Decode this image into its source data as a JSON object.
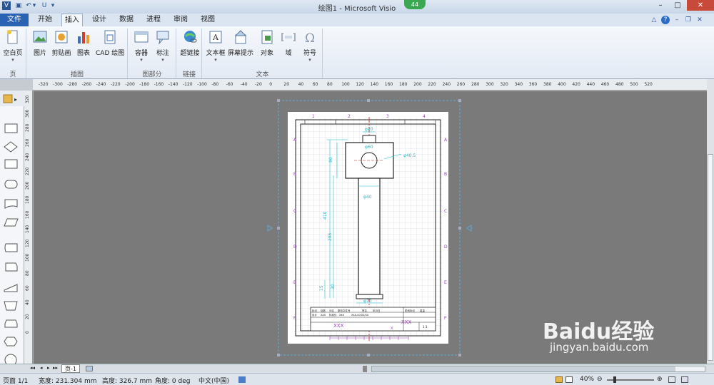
{
  "window": {
    "title": "绘图1 - Microsoft Visio",
    "badge": "44",
    "minimize": "–",
    "maximize": "□",
    "close": "✕"
  },
  "qat": {
    "app_icon": "V",
    "save": "▣",
    "undo": "↶",
    "undo_dd": "▾",
    "redo": "U",
    "customize": "▾"
  },
  "tabs": [
    {
      "label": "文件"
    },
    {
      "label": "开始"
    },
    {
      "label": "插入"
    },
    {
      "label": "设计"
    },
    {
      "label": "数据"
    },
    {
      "label": "进程"
    },
    {
      "label": "审阅"
    },
    {
      "label": "视图"
    }
  ],
  "tabbar_icons": {
    "collapse": "△",
    "help": "?",
    "minimize": "–",
    "restore": "❐",
    "close": "✕"
  },
  "ribbon": {
    "buttons": [
      {
        "label": "空白页",
        "icon": "blank-page-icon",
        "dd": "▾"
      },
      {
        "label": "图片",
        "icon": "picture-icon",
        "dd": ""
      },
      {
        "label": "剪贴画",
        "icon": "clipart-icon",
        "dd": ""
      },
      {
        "label": "图表",
        "icon": "chart-icon",
        "dd": ""
      },
      {
        "label": "CAD 绘图",
        "icon": "cad-icon",
        "dd": ""
      },
      {
        "label": "容器",
        "icon": "container-icon",
        "dd": "▾"
      },
      {
        "label": "标注",
        "icon": "callout-icon",
        "dd": "▾"
      },
      {
        "label": "超链接",
        "icon": "hyperlink-icon",
        "dd": ""
      },
      {
        "label": "文本框",
        "icon": "textbox-icon",
        "dd": "▾"
      },
      {
        "label": "屏幕提示",
        "icon": "screentip-icon",
        "dd": ""
      },
      {
        "label": "对象",
        "icon": "object-icon",
        "dd": ""
      },
      {
        "label": "域",
        "icon": "field-icon",
        "dd": ""
      },
      {
        "label": "符号",
        "icon": "symbol-icon",
        "dd": "▾"
      }
    ],
    "groups": [
      {
        "label": "页"
      },
      {
        "label": "插图"
      },
      {
        "label": "图部分"
      },
      {
        "label": "链接"
      },
      {
        "label": "文本"
      }
    ]
  },
  "ruler": {
    "h_ticks": [
      "-320",
      "-300",
      "-280",
      "-260",
      "-240",
      "-220",
      "-200",
      "-180",
      "-160",
      "-140",
      "-120",
      "-100",
      "-80",
      "-60",
      "-40",
      "-20",
      "0",
      "20",
      "40",
      "60",
      "80",
      "100",
      "120",
      "140",
      "160",
      "180",
      "200",
      "220",
      "240",
      "260",
      "280",
      "300",
      "320",
      "340",
      "360",
      "380",
      "400",
      "420",
      "440",
      "460",
      "480",
      "500",
      "520"
    ],
    "v_ticks": [
      "320",
      "300",
      "280",
      "260",
      "240",
      "220",
      "200",
      "180",
      "160",
      "140",
      "120",
      "100",
      "80",
      "60",
      "40",
      "20",
      "0"
    ]
  },
  "shapes_panel": {
    "header_icon": "shapes-icon",
    "arrow": "▸"
  },
  "drawing": {
    "dims": [
      "φ20",
      "φ60",
      "φ40.5",
      "φ40",
      "φ70",
      "90",
      "410",
      "295",
      "15",
      "30"
    ],
    "zone_cols": [
      "1",
      "2",
      "3",
      "4"
    ],
    "zone_rows": [
      "A",
      "B",
      "C",
      "D",
      "E",
      "F"
    ],
    "title_block": {
      "row1": [
        "标记",
        "处数",
        "分区",
        "更改文件号",
        "签名",
        "年月日"
      ],
      "row2": [
        "设计",
        "XXX",
        "标准化",
        "XXX",
        "XXX-00/00/00"
      ],
      "cell_xxx": "XXX",
      "cell_x": "X",
      "scale": "1:1",
      "weight": "重量",
      "stage": "阶段标记"
    }
  },
  "page_tab": {
    "label": "页-1",
    "nav": [
      "◂◂",
      "◂",
      "▸",
      "▸▸"
    ]
  },
  "status": {
    "page": "页面 1/1",
    "width": "宽度: 231.304 mm",
    "height": "高度: 326.7 mm",
    "angle": "角度: 0 deg",
    "lang": "中文(中国)",
    "zoom": "40%",
    "zoom_minus": "⊖",
    "zoom_plus": "⊕"
  },
  "watermark": {
    "brand": "Baidu经验",
    "url": "jingyan.baidu.com"
  }
}
